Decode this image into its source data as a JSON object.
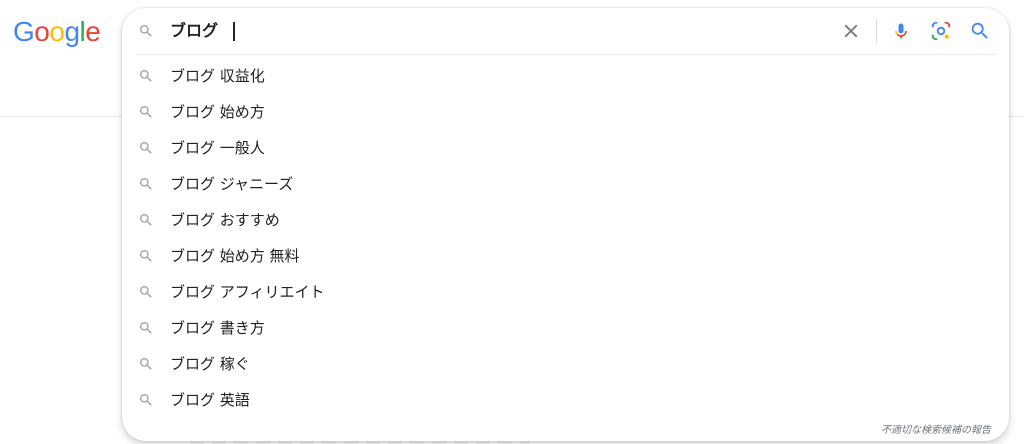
{
  "logo": {
    "letters": [
      {
        "char": "G",
        "color": "#4285F4"
      },
      {
        "char": "o",
        "color": "#EA4335"
      },
      {
        "char": "o",
        "color": "#FBBC05"
      },
      {
        "char": "g",
        "color": "#4285F4"
      },
      {
        "char": "l",
        "color": "#34A853"
      },
      {
        "char": "e",
        "color": "#EA4335"
      }
    ]
  },
  "search": {
    "query": "ブログ",
    "icons": {
      "left": "search-icon",
      "clear": "close-icon",
      "voice": "microphone-icon",
      "image": "google-lens-icon",
      "submit": "search-icon"
    },
    "colors": {
      "icon_gray": "#9aa0a6",
      "clear_icon": "#70757a",
      "submit_blue": "#4285F4"
    }
  },
  "suggestions": [
    {
      "text": "ブログ 収益化"
    },
    {
      "text": "ブログ 始め方"
    },
    {
      "text": "ブログ 一般人"
    },
    {
      "text": "ブログ ジャニーズ"
    },
    {
      "text": "ブログ おすすめ"
    },
    {
      "text": "ブログ 始め方 無料"
    },
    {
      "text": "ブログ アフィリエイト"
    },
    {
      "text": "ブログ 書き方"
    },
    {
      "text": "ブログ 稼ぐ"
    },
    {
      "text": "ブログ 英語"
    }
  ],
  "report_label": "不適切な検索候補の報告"
}
